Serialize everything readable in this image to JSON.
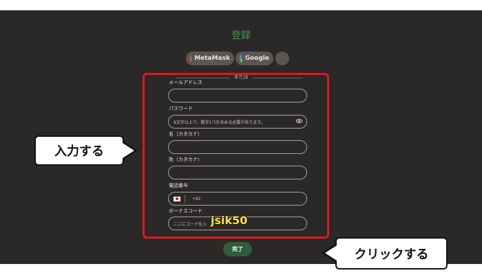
{
  "form": {
    "title": "登録",
    "social": {
      "metamask_label": "MetaMask",
      "google_label": "Google"
    },
    "divider_text": "または",
    "email": {
      "label": "メールアドレス",
      "value": ""
    },
    "password": {
      "label": "パスワード",
      "placeholder": "8文字以上で、数字1つを含める必要があります。"
    },
    "first_name": {
      "label": "名（カタカナ）",
      "value": ""
    },
    "last_name": {
      "label": "姓（カタカナ）",
      "value": ""
    },
    "phone": {
      "label": "電話番号",
      "country_code": "+81"
    },
    "bonus_code": {
      "label": "ボーナスコード",
      "placeholder": "ここにコードを入"
    },
    "submit_label": "完了"
  },
  "annotations": {
    "input_callout": "入力する",
    "click_callout": "クリックする",
    "code_overlay": "jsik50"
  },
  "colors": {
    "background": "#2b2828",
    "accent_green": "#3a9a4c",
    "submit_green": "#2c5e39",
    "highlight_red": "#e8141e",
    "code_yellow": "#ffe23a"
  }
}
